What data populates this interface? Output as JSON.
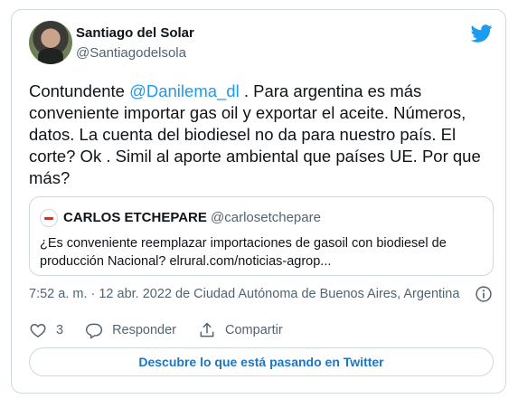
{
  "author": {
    "name": "Santiago del Solar",
    "handle": "@Santiagodelsola"
  },
  "tweet": {
    "text_before_mention": "Contundente ",
    "mention": "@Danilema_dl",
    "text_after_mention": " . Para argentina es más conveniente importar gas oil y exportar el aceite. Números, datos. La cuenta del biodiesel no da para nuestro país. El corte? Ok . Simil al aporte ambiental que países UE. Por que más?"
  },
  "quoted_tweet": {
    "name": "CARLOS ETCHEPARE",
    "handle": "@carlosetchepare",
    "text": "¿Es conveniente reemplazar importaciones de  gasoil con biodiesel de producción Nacional? elrural.com/noticias-agrop..."
  },
  "meta": {
    "timestamp": "7:52 a. m. · 12 abr. 2022 de Ciudad Autónoma de Buenos Aires, Argentina"
  },
  "actions": {
    "like_count": "3",
    "reply_label": "Responder",
    "share_label": "Compartir"
  },
  "cta": {
    "label": "Descubre lo que está pasando en Twitter"
  },
  "icons": {
    "brand": "twitter-bird-icon",
    "like": "heart-icon",
    "reply": "reply-bubble-icon",
    "share": "share-upload-icon",
    "info": "info-icon"
  },
  "colors": {
    "accent": "#1d9bf0",
    "cta_text": "#1d75c4",
    "secondary_text": "#536471",
    "border": "#cfd9de"
  }
}
